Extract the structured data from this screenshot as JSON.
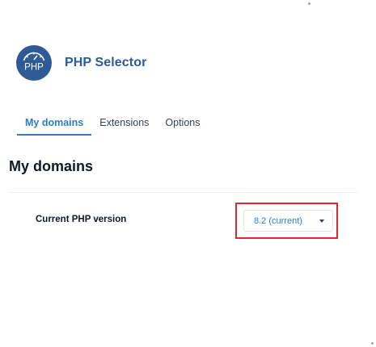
{
  "app": {
    "title": "PHP Selector",
    "logo_text": "PHP",
    "accent_color": "#2b5a97",
    "logo_bg_color": "#2e5a96"
  },
  "tabs": [
    {
      "label": "My domains",
      "active": true
    },
    {
      "label": "Extensions",
      "active": false
    },
    {
      "label": "Options",
      "active": false
    }
  ],
  "section": {
    "title": "My domains"
  },
  "php_version": {
    "label": "Current PHP version",
    "selected": "8.2 (current)",
    "icon": "chevron-down-icon",
    "highlight_color": "#e1262d"
  }
}
